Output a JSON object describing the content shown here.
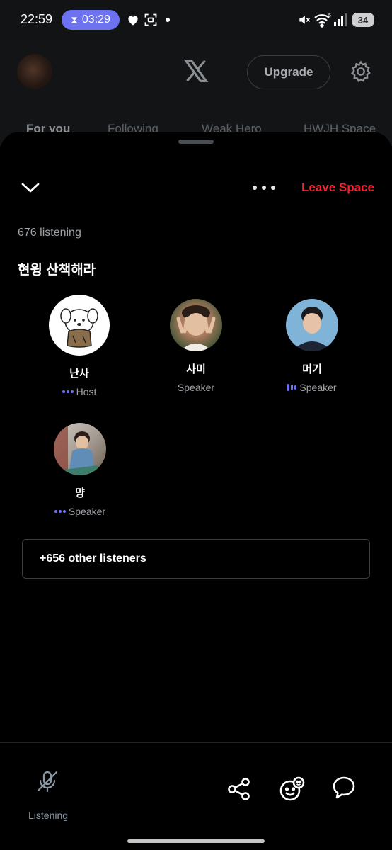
{
  "status_bar": {
    "time": "22:59",
    "timer": "03:29",
    "battery": "34",
    "wifi_badge": "5"
  },
  "background_header": {
    "upgrade_label": "Upgrade",
    "tabs": [
      "For you",
      "Following",
      "Weak Hero",
      "HWJH Space"
    ]
  },
  "space": {
    "leave_label": "Leave Space",
    "listening_count": "676 listening",
    "title": "현윙 산책해라",
    "participants": [
      {
        "name": "난사",
        "role": "Host"
      },
      {
        "name": "사미",
        "role": "Speaker"
      },
      {
        "name": "머기",
        "role": "Speaker"
      },
      {
        "name": "먕",
        "role": "Speaker"
      }
    ],
    "listeners_label": "+656 other listeners"
  },
  "bottom_bar": {
    "mic_label": "Listening"
  },
  "colors": {
    "accent": "#6c72f0",
    "leave": "#f4212e",
    "background": "#000000"
  }
}
